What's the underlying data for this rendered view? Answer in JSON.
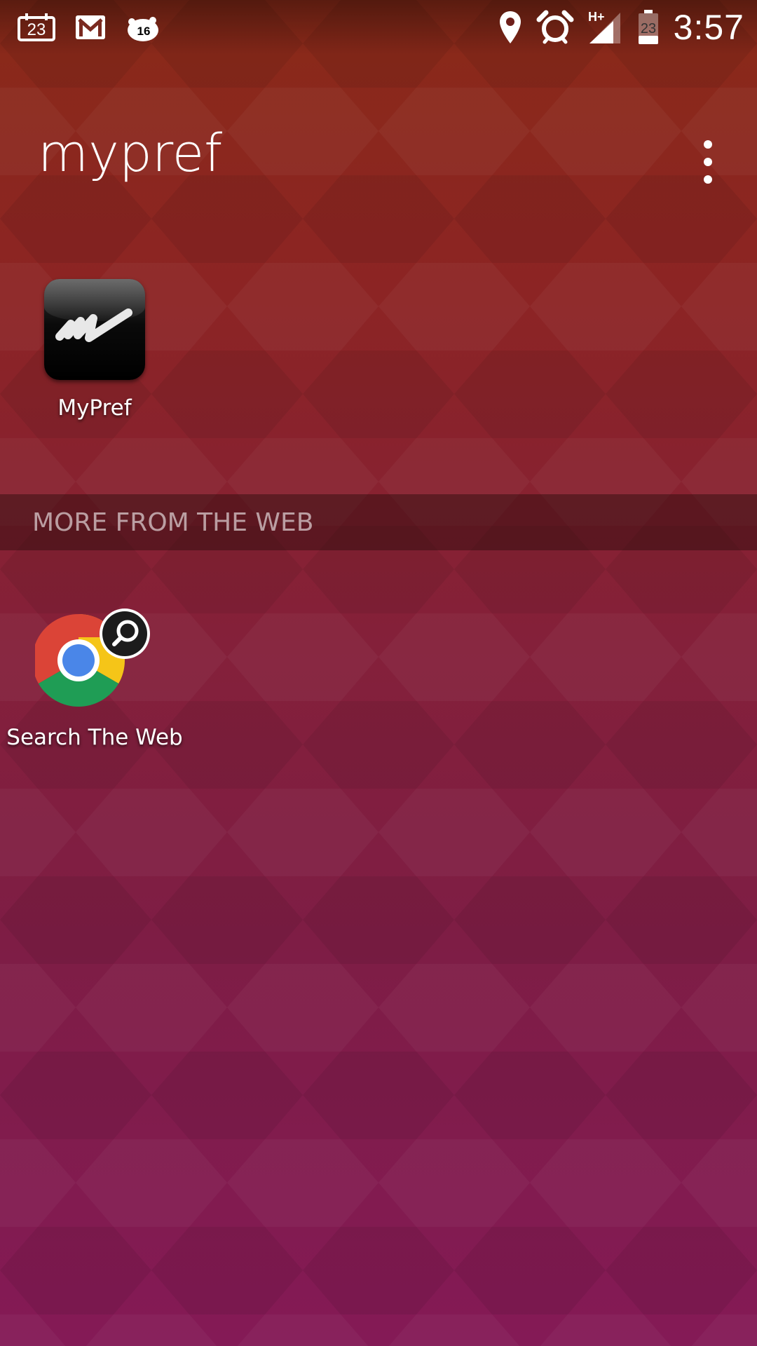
{
  "status_bar": {
    "calendar_date": "23",
    "notification_badge": "16",
    "network_type": "H+",
    "battery_level": "23",
    "time": "3:57",
    "icons": [
      "calendar-icon",
      "gmail-icon",
      "sleep-tracker-icon",
      "location-icon",
      "alarm-icon",
      "signal-icon",
      "battery-icon"
    ]
  },
  "folder": {
    "title": "mypref",
    "menu_icon": "overflow-menu-icon"
  },
  "apps": [
    {
      "label": "MyPref",
      "icon": "mypref-app-icon"
    }
  ],
  "web_section": {
    "header": "MORE FROM THE WEB",
    "items": [
      {
        "label": "Search The Web",
        "icon": "chrome-search-icon"
      }
    ]
  },
  "colors": {
    "background_top": "#8a2a18",
    "background_bottom": "#841a56",
    "text": "#ffffff"
  }
}
